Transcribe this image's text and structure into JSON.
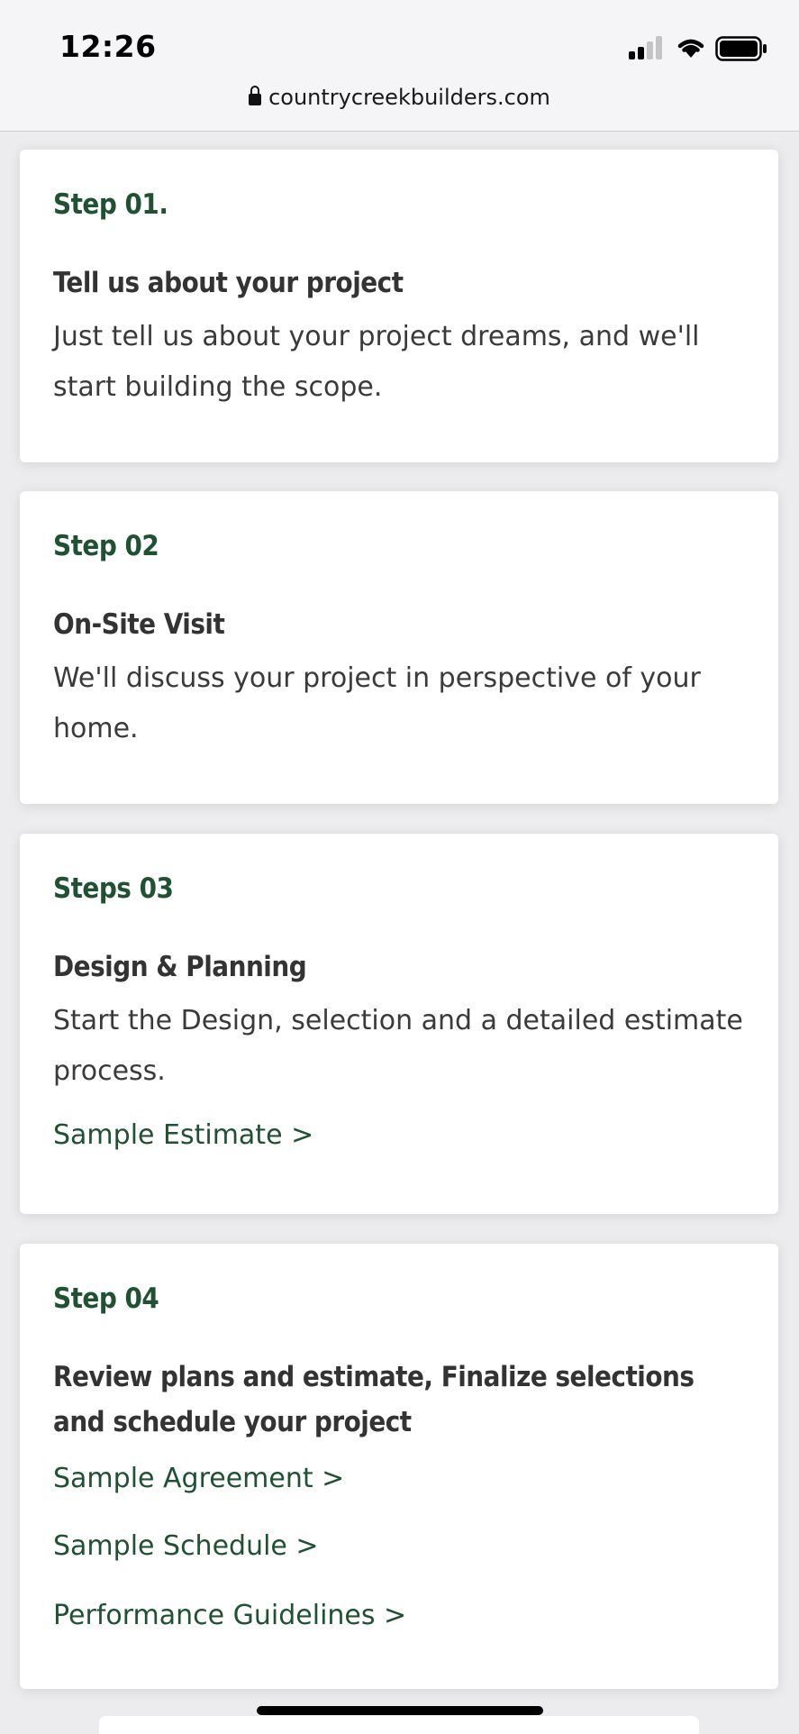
{
  "status_bar": {
    "time": "12:26"
  },
  "browser": {
    "url": "countrycreekbuilders.com"
  },
  "steps": [
    {
      "label": "Step 01.",
      "title": "Tell us about your project",
      "description": "Just tell us about your project dreams, and we'll start building the scope."
    },
    {
      "label": "Step 02",
      "title": "On-Site Visit",
      "description": "We'll discuss your project in perspective of your home."
    },
    {
      "label": "Steps 03",
      "title": "Design & Planning",
      "description": "Start the Design, selection and a detailed estimate process.",
      "links": [
        "Sample Estimate >"
      ]
    },
    {
      "label": "Step 04",
      "title": "Review plans and estimate, Finalize selections and schedule your project",
      "links": [
        "Sample Agreement >",
        "Sample Schedule >",
        "Performance Guidelines >"
      ]
    }
  ],
  "colors": {
    "accent": "#1f5133",
    "heading": "#333333",
    "background": "#ececee"
  }
}
